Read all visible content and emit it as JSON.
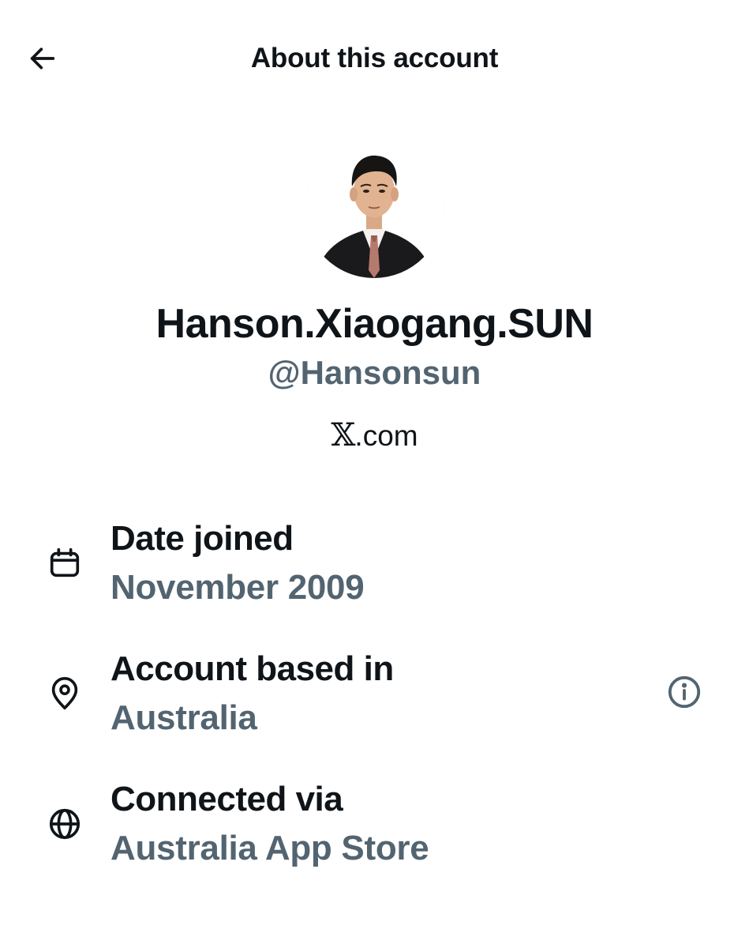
{
  "header": {
    "title": "About this account",
    "back_icon": "arrow-left-icon"
  },
  "profile": {
    "display_name": "Hanson.Xiaogang.SUN",
    "handle": "@Hansonsun",
    "site_glyph": "𝕏",
    "site_suffix": ".com"
  },
  "details": [
    {
      "icon": "calendar-icon",
      "label": "Date joined",
      "value": "November 2009"
    },
    {
      "icon": "location-pin-icon",
      "label": "Account based in",
      "value": "Australia",
      "info_icon": "info-icon"
    },
    {
      "icon": "globe-icon",
      "label": "Connected via",
      "value": "Australia App Store"
    }
  ],
  "colors": {
    "primary_text": "#0f1419",
    "secondary_text": "#536471",
    "background": "#ffffff"
  }
}
